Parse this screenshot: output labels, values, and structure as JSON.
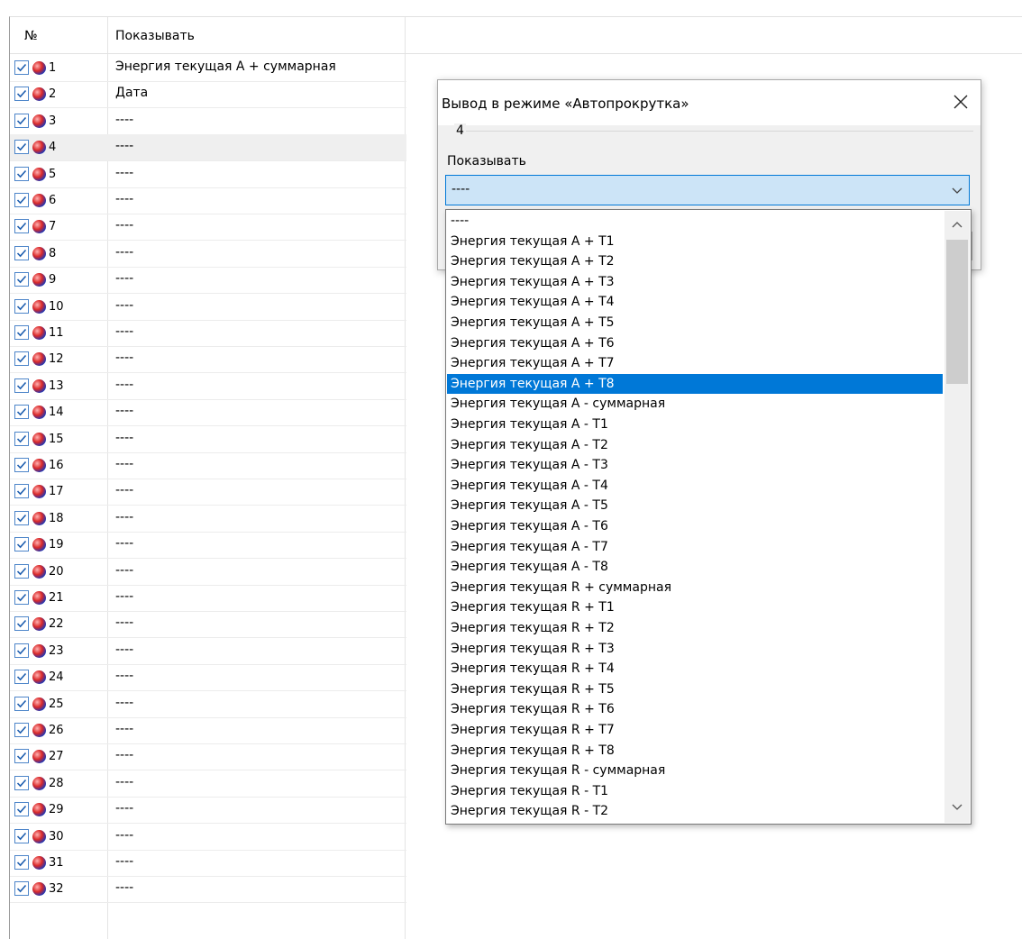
{
  "list": {
    "col_num": "№",
    "col_show": "Показывать",
    "selected_row": 4,
    "rows": [
      {
        "num": "1",
        "value": "Энергия текущая А + суммарная",
        "checked": true
      },
      {
        "num": "2",
        "value": "Дата",
        "checked": true
      },
      {
        "num": "3",
        "value": "----",
        "checked": true
      },
      {
        "num": "4",
        "value": "----",
        "checked": true
      },
      {
        "num": "5",
        "value": "----",
        "checked": true
      },
      {
        "num": "6",
        "value": "----",
        "checked": true
      },
      {
        "num": "7",
        "value": "----",
        "checked": true
      },
      {
        "num": "8",
        "value": "----",
        "checked": true
      },
      {
        "num": "9",
        "value": "----",
        "checked": true
      },
      {
        "num": "10",
        "value": "----",
        "checked": true
      },
      {
        "num": "11",
        "value": "----",
        "checked": true
      },
      {
        "num": "12",
        "value": "----",
        "checked": true
      },
      {
        "num": "13",
        "value": "----",
        "checked": true
      },
      {
        "num": "14",
        "value": "----",
        "checked": true
      },
      {
        "num": "15",
        "value": "----",
        "checked": true
      },
      {
        "num": "16",
        "value": "----",
        "checked": true
      },
      {
        "num": "17",
        "value": "----",
        "checked": true
      },
      {
        "num": "18",
        "value": "----",
        "checked": true
      },
      {
        "num": "19",
        "value": "----",
        "checked": true
      },
      {
        "num": "20",
        "value": "----",
        "checked": true
      },
      {
        "num": "21",
        "value": "----",
        "checked": true
      },
      {
        "num": "22",
        "value": "----",
        "checked": true
      },
      {
        "num": "23",
        "value": "----",
        "checked": true
      },
      {
        "num": "24",
        "value": "----",
        "checked": true
      },
      {
        "num": "25",
        "value": "----",
        "checked": true
      },
      {
        "num": "26",
        "value": "----",
        "checked": true
      },
      {
        "num": "27",
        "value": "----",
        "checked": true
      },
      {
        "num": "28",
        "value": "----",
        "checked": true
      },
      {
        "num": "29",
        "value": "----",
        "checked": true
      },
      {
        "num": "30",
        "value": "----",
        "checked": true
      },
      {
        "num": "31",
        "value": "----",
        "checked": true
      },
      {
        "num": "32",
        "value": "----",
        "checked": true
      }
    ]
  },
  "dialog": {
    "title": "Вывод в режиме «Автопрокрутка»",
    "group_number": "4",
    "field_label": "Показывать",
    "combo_value": "----",
    "options": [
      "----",
      "Энергия текущая А + Т1",
      "Энергия текущая А + Т2",
      "Энергия текущая А + Т3",
      "Энергия текущая А + Т4",
      "Энергия текущая А + Т5",
      "Энергия текущая А + Т6",
      "Энергия текущая А + Т7",
      "Энергия текущая А + Т8",
      "Энергия текущая А - суммарная",
      "Энергия текущая А - Т1",
      "Энергия текущая А - Т2",
      "Энергия текущая А - Т3",
      "Энергия текущая А - Т4",
      "Энергия текущая А - Т5",
      "Энергия текущая А - Т6",
      "Энергия текущая А - Т7",
      "Энергия текущая А - Т8",
      "Энергия текущая R + суммарная",
      "Энергия текущая R + Т1",
      "Энергия текущая R + Т2",
      "Энергия текущая R + Т3",
      "Энергия текущая R + Т4",
      "Энергия текущая R + Т5",
      "Энергия текущая R + Т6",
      "Энергия текущая R + Т7",
      "Энергия текущая R + Т8",
      "Энергия текущая R - суммарная",
      "Энергия текущая R - Т1",
      "Энергия текущая R - Т2"
    ],
    "highlighted_option": "Энергия текущая А + Т8"
  },
  "icons": {
    "checkbox": "checkbox-checked-icon",
    "status": "status-ball-icon",
    "close": "close-icon",
    "combo_arrow": "chevron-down-icon",
    "scroll_up": "scroll-up-icon",
    "scroll_down": "scroll-down-icon"
  },
  "colors": {
    "accent": "#0078d7",
    "combo_bg": "#cce4f7",
    "checkbox_border": "#4d85c9",
    "dialog_bg": "#f0f0f0"
  }
}
